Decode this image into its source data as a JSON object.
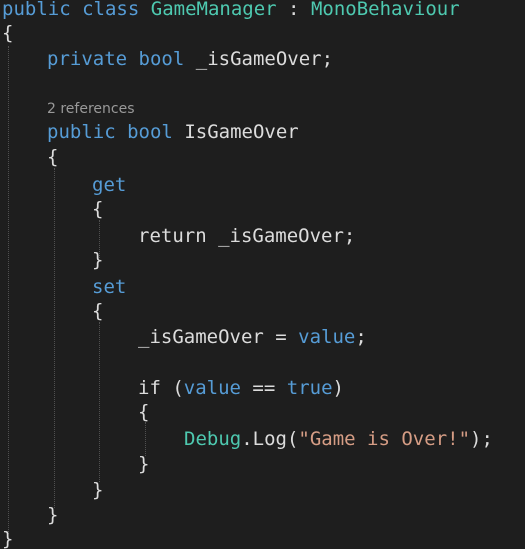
{
  "colors": {
    "background": "#1e1e1e",
    "keyword": "#569cd6",
    "type": "#4ec9b0",
    "plain": "#dcdcdc",
    "string": "#d69d85",
    "codelens": "#999999"
  },
  "code": {
    "line1": {
      "kw1": "public",
      "kw2": "class",
      "class_name": "GameManager",
      "colon": ":",
      "base": "MonoBehaviour"
    },
    "line2": {
      "brace": "{"
    },
    "line3": {
      "kw1": "private",
      "kw2": "bool",
      "name": "_isGameOver;"
    },
    "codelens": "2 references",
    "line5": {
      "kw1": "public",
      "kw2": "bool",
      "name": "IsGameOver"
    },
    "line6": {
      "brace": "{"
    },
    "line7": {
      "kw": "get"
    },
    "line8": {
      "brace": "{"
    },
    "line9": {
      "text": "return _isGameOver;"
    },
    "line10": {
      "brace": "}"
    },
    "line11": {
      "kw": "set"
    },
    "line12": {
      "brace": "{"
    },
    "line13": {
      "lhs": "_isGameOver =",
      "kw": "value",
      "end": ";"
    },
    "line15": {
      "if_open": "if (",
      "kw1": "value",
      "eq": "==",
      "kw2": "true",
      "close": ")"
    },
    "line16": {
      "brace": "{"
    },
    "line17": {
      "type": "Debug",
      "dot": ".",
      "method": "Log(",
      "str": "\"Game is Over!\"",
      "end": ");"
    },
    "line18": {
      "brace": "}"
    },
    "line19": {
      "brace": "}"
    },
    "line20": {
      "brace": "}"
    },
    "line21": {
      "brace": "}"
    }
  }
}
